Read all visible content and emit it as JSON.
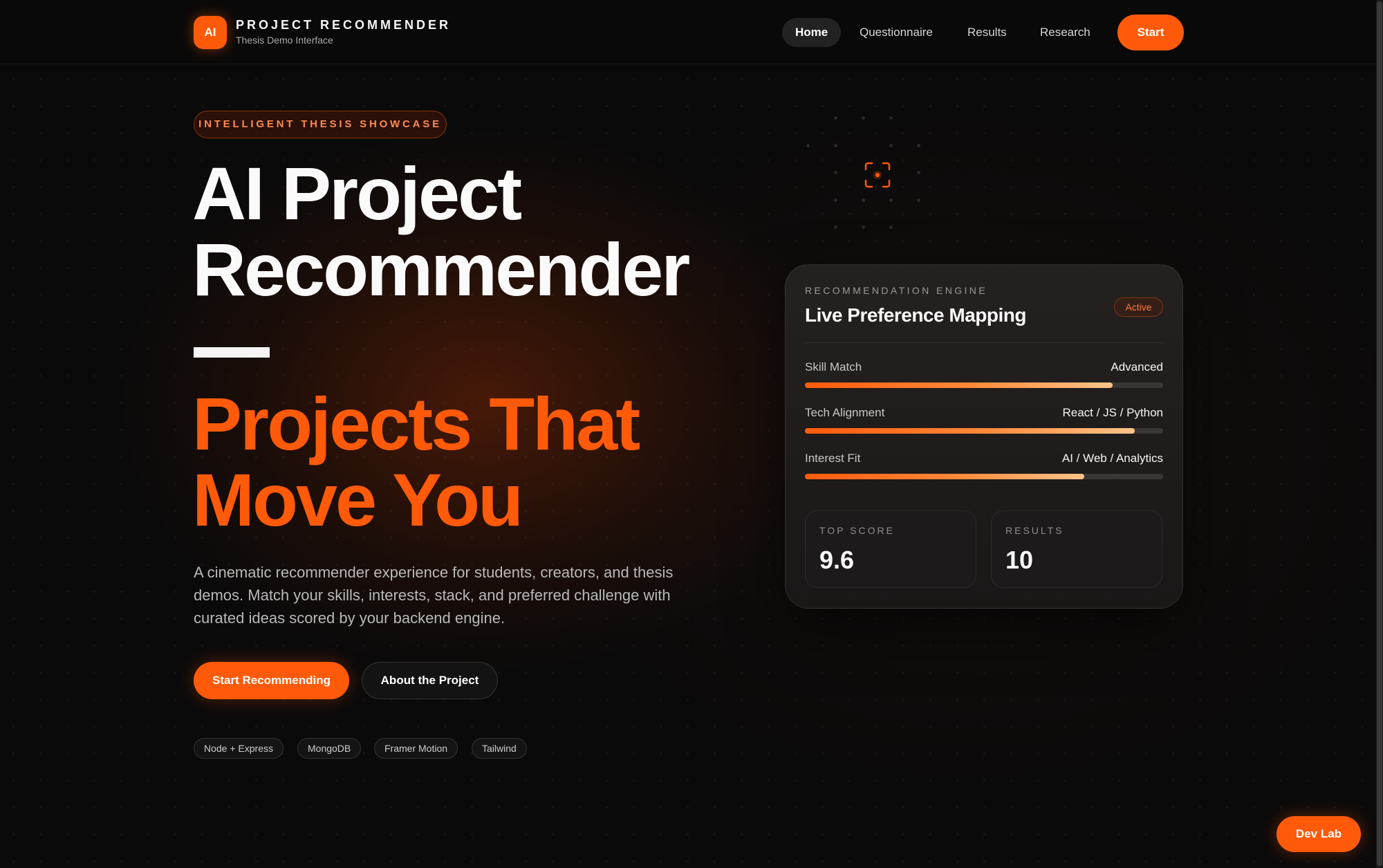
{
  "nav": {
    "logo_text": "AI",
    "brand_title": "PROJECT RECOMMENDER",
    "brand_subtitle": "Thesis Demo Interface",
    "links": [
      {
        "label": "Home",
        "active": true
      },
      {
        "label": "Questionnaire",
        "active": false
      },
      {
        "label": "Results",
        "active": false
      },
      {
        "label": "Research",
        "active": false
      }
    ],
    "start_label": "Start"
  },
  "hero": {
    "eyebrow": "INTELLIGENT THESIS SHOWCASE",
    "title_line1": "AI Project",
    "title_line2": "Recommender",
    "tagline_line1": "Projects That",
    "tagline_line2": "Move You",
    "description": "A cinematic recommender experience for students, creators, and thesis demos. Match your skills, interests, stack, and preferred challenge with curated ideas scored by your backend engine.",
    "primary_button": "Start Recommending",
    "secondary_button": "About the Project",
    "tags": [
      "Node + Express",
      "MongoDB",
      "Framer Motion",
      "Tailwind"
    ]
  },
  "card": {
    "eyebrow": "RECOMMENDATION ENGINE",
    "title": "Live Preference Mapping",
    "status": "Active",
    "metrics": [
      {
        "label": "Skill Match",
        "value": "Advanced",
        "fill_percent": 86
      },
      {
        "label": "Tech Alignment",
        "value": "React / JS / Python",
        "fill_percent": 92
      },
      {
        "label": "Interest Fit",
        "value": "AI / Web / Analytics",
        "fill_percent": 78
      }
    ],
    "stats": [
      {
        "label": "TOP SCORE",
        "value": "9.6"
      },
      {
        "label": "RESULTS",
        "value": "10"
      }
    ]
  },
  "floating_button": "Dev Lab",
  "colors": {
    "accent": "#ff5a0a",
    "background": "#0b0a0a",
    "card": "#1f1c1c"
  },
  "icons": {
    "focus": "focus-target-icon"
  }
}
